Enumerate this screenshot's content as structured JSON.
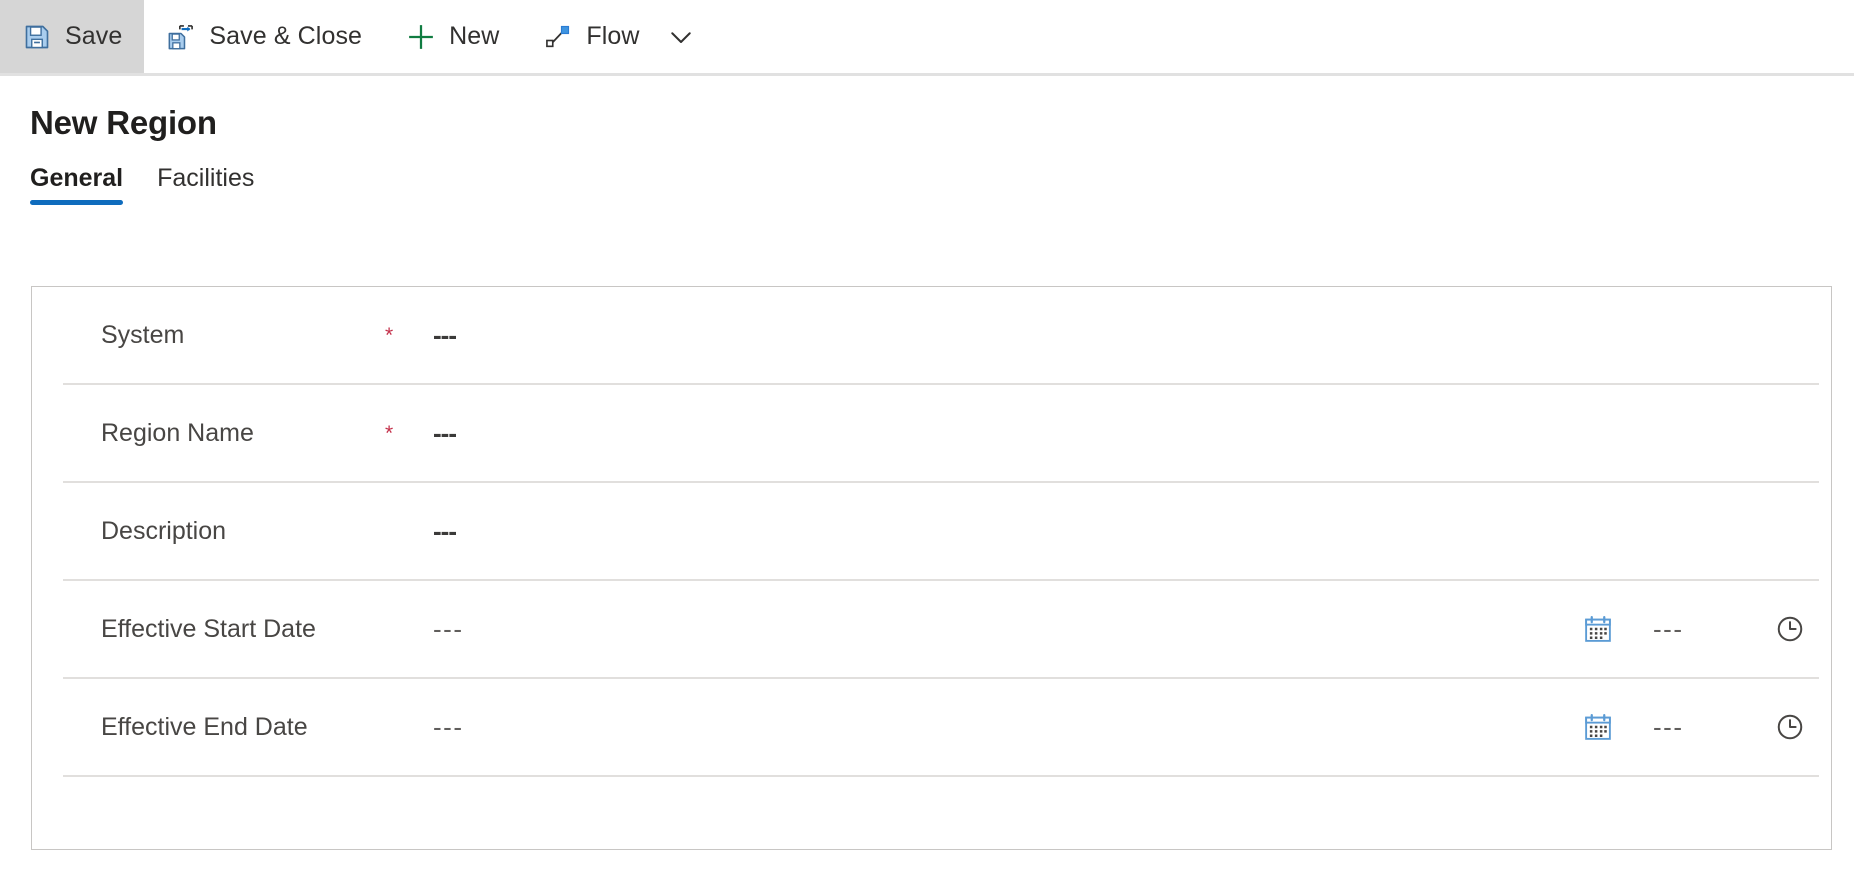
{
  "toolbar": {
    "buttons": [
      {
        "label": "Save",
        "icon": "save-icon",
        "active": true
      },
      {
        "label": "Save & Close",
        "icon": "save-and-close-icon",
        "active": false
      },
      {
        "label": "New",
        "icon": "plus-icon",
        "active": false
      },
      {
        "label": "Flow",
        "icon": "flow-icon",
        "active": false
      }
    ],
    "overflow_icon": "chevron-down-icon"
  },
  "page": {
    "title": "New Region"
  },
  "tabs": [
    {
      "label": "General",
      "selected": true
    },
    {
      "label": "Facilities",
      "selected": false
    }
  ],
  "form": {
    "rows": [
      {
        "label": "System",
        "required": true,
        "required_mark": "*",
        "value": "---",
        "type": "text"
      },
      {
        "label": "Region Name",
        "required": true,
        "required_mark": "*",
        "value": "---",
        "type": "text"
      },
      {
        "label": "Description",
        "required": false,
        "required_mark": "",
        "value": "---",
        "type": "text"
      },
      {
        "label": "Effective Start Date",
        "required": false,
        "required_mark": "",
        "value": "---",
        "time_value": "---",
        "type": "datetime",
        "date_icon": "calendar-icon",
        "time_icon": "clock-icon"
      },
      {
        "label": "Effective End Date",
        "required": false,
        "required_mark": "",
        "value": "---",
        "time_value": "---",
        "type": "datetime",
        "date_icon": "calendar-icon",
        "time_icon": "clock-icon"
      }
    ]
  },
  "colors": {
    "accent": "#0f6cbd",
    "required": "#c4314b",
    "icon_blue": "#5b9bd5",
    "icon_green": "#107c41",
    "divider": "#e1dfdd",
    "panel_border": "#c8c6c4",
    "active_btn_bg": "#d6d6d6"
  }
}
